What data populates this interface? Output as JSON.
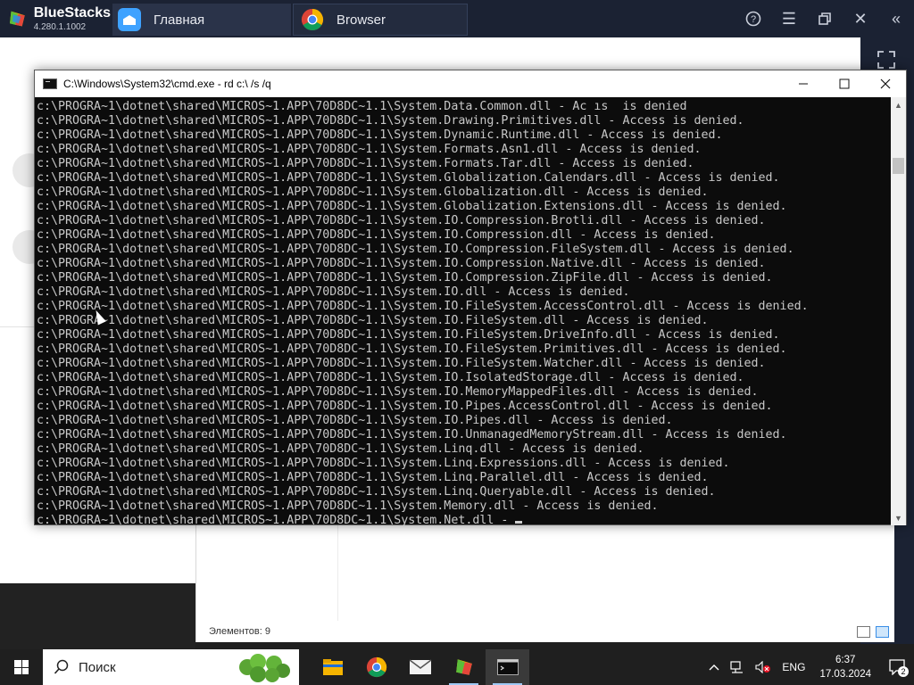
{
  "bluestacks": {
    "app_name": "BlueStacks",
    "version": "4.280.1.1002",
    "tabs": [
      {
        "label": "Главная",
        "icon": "home-icon"
      },
      {
        "label": "Browser",
        "icon": "chrome-icon"
      }
    ],
    "controls": [
      "help-icon",
      "menu-icon",
      "restore-icon",
      "close-icon",
      "collapse-icon"
    ]
  },
  "cmd": {
    "title": "C:\\Windows\\System32\\cmd.exe - rd  c:\\ /s /q",
    "lines": [
      "c:\\PROGRA~1\\dotnet\\shared\\MICROS~1.APP\\70D8DC~1.1\\System.Data.Common.dll - Ac ıs  is denied",
      "c:\\PROGRA~1\\dotnet\\shared\\MICROS~1.APP\\70D8DC~1.1\\System.Drawing.Primitives.dll - Access is denied.",
      "c:\\PROGRA~1\\dotnet\\shared\\MICROS~1.APP\\70D8DC~1.1\\System.Dynamic.Runtime.dll - Access is denied.",
      "c:\\PROGRA~1\\dotnet\\shared\\MICROS~1.APP\\70D8DC~1.1\\System.Formats.Asn1.dll - Access is denied.",
      "c:\\PROGRA~1\\dotnet\\shared\\MICROS~1.APP\\70D8DC~1.1\\System.Formats.Tar.dll - Access is denied.",
      "c:\\PROGRA~1\\dotnet\\shared\\MICROS~1.APP\\70D8DC~1.1\\System.Globalization.Calendars.dll - Access is denied.",
      "c:\\PROGRA~1\\dotnet\\shared\\MICROS~1.APP\\70D8DC~1.1\\System.Globalization.dll - Access is denied.",
      "c:\\PROGRA~1\\dotnet\\shared\\MICROS~1.APP\\70D8DC~1.1\\System.Globalization.Extensions.dll - Access is denied.",
      "c:\\PROGRA~1\\dotnet\\shared\\MICROS~1.APP\\70D8DC~1.1\\System.IO.Compression.Brotli.dll - Access is denied.",
      "c:\\PROGRA~1\\dotnet\\shared\\MICROS~1.APP\\70D8DC~1.1\\System.IO.Compression.dll - Access is denied.",
      "c:\\PROGRA~1\\dotnet\\shared\\MICROS~1.APP\\70D8DC~1.1\\System.IO.Compression.FileSystem.dll - Access is denied.",
      "c:\\PROGRA~1\\dotnet\\shared\\MICROS~1.APP\\70D8DC~1.1\\System.IO.Compression.Native.dll - Access is denied.",
      "c:\\PROGRA~1\\dotnet\\shared\\MICROS~1.APP\\70D8DC~1.1\\System.IO.Compression.ZipFile.dll - Access is denied.",
      "c:\\PROGRA~1\\dotnet\\shared\\MICROS~1.APP\\70D8DC~1.1\\System.IO.dll - Access is denied.",
      "c:\\PROGRA~1\\dotnet\\shared\\MICROS~1.APP\\70D8DC~1.1\\System.IO.FileSystem.AccessControl.dll - Access is denied.",
      "c:\\PROGRA~1\\dotnet\\shared\\MICROS~1.APP\\70D8DC~1.1\\System.IO.FileSystem.dll - Access is denied.",
      "c:\\PROGRA~1\\dotnet\\shared\\MICROS~1.APP\\70D8DC~1.1\\System.IO.FileSystem.DriveInfo.dll - Access is denied.",
      "c:\\PROGRA~1\\dotnet\\shared\\MICROS~1.APP\\70D8DC~1.1\\System.IO.FileSystem.Primitives.dll - Access is denied.",
      "c:\\PROGRA~1\\dotnet\\shared\\MICROS~1.APP\\70D8DC~1.1\\System.IO.FileSystem.Watcher.dll - Access is denied.",
      "c:\\PROGRA~1\\dotnet\\shared\\MICROS~1.APP\\70D8DC~1.1\\System.IO.IsolatedStorage.dll - Access is denied.",
      "c:\\PROGRA~1\\dotnet\\shared\\MICROS~1.APP\\70D8DC~1.1\\System.IO.MemoryMappedFiles.dll - Access is denied.",
      "c:\\PROGRA~1\\dotnet\\shared\\MICROS~1.APP\\70D8DC~1.1\\System.IO.Pipes.AccessControl.dll - Access is denied.",
      "c:\\PROGRA~1\\dotnet\\shared\\MICROS~1.APP\\70D8DC~1.1\\System.IO.Pipes.dll - Access is denied.",
      "c:\\PROGRA~1\\dotnet\\shared\\MICROS~1.APP\\70D8DC~1.1\\System.IO.UnmanagedMemoryStream.dll - Access is denied.",
      "c:\\PROGRA~1\\dotnet\\shared\\MICROS~1.APP\\70D8DC~1.1\\System.Linq.dll - Access is denied.",
      "c:\\PROGRA~1\\dotnet\\shared\\MICROS~1.APP\\70D8DC~1.1\\System.Linq.Expressions.dll - Access is denied.",
      "c:\\PROGRA~1\\dotnet\\shared\\MICROS~1.APP\\70D8DC~1.1\\System.Linq.Parallel.dll - Access is denied.",
      "c:\\PROGRA~1\\dotnet\\shared\\MICROS~1.APP\\70D8DC~1.1\\System.Linq.Queryable.dll - Access is denied.",
      "c:\\PROGRA~1\\dotnet\\shared\\MICROS~1.APP\\70D8DC~1.1\\System.Memory.dll - Access is denied.",
      "c:\\PROGRA~1\\dotnet\\shared\\MICROS~1.APP\\70D8DC~1.1\\System.Net.dll - "
    ]
  },
  "explorer": {
    "status": "Элементов: 9"
  },
  "taskbar": {
    "search_placeholder": "Поиск",
    "apps": [
      "file-explorer-icon",
      "chrome-icon",
      "mail-icon",
      "bluestacks-icon",
      "cmd-icon"
    ],
    "language": "ENG",
    "time": "6:37",
    "date": "17.03.2024",
    "notifications": "2"
  },
  "colors": {
    "bluestacks_bar": "#1b2233",
    "cmd_background": "#0c0c0c",
    "cmd_text": "#c8c8c8",
    "taskbar": "#1f1f1f"
  }
}
